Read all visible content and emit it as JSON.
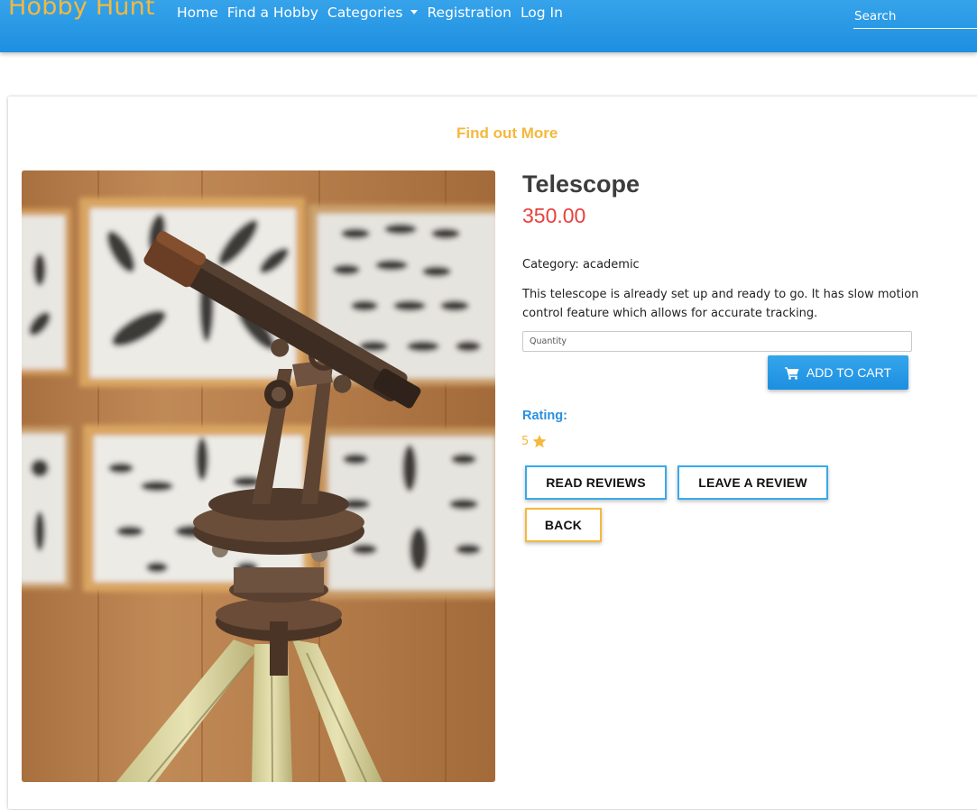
{
  "navbar": {
    "brand": "Hobby Hunt",
    "links": [
      "Home",
      "Find a Hobby",
      "Categories",
      "Registration",
      "Log In"
    ],
    "search_placeholder": "Search"
  },
  "page": {
    "section_heading": "Find out More"
  },
  "product": {
    "title": "Telescope",
    "price": "350.00",
    "category_label": "Category: academic",
    "description": "This telescope is already set up and ready to go. It has slow motion control feature which allows for accurate tracking.",
    "quantity_placeholder": "Quantity",
    "add_to_cart_label": "ADD TO CART",
    "rating_label": "Rating:",
    "rating_value": "5"
  },
  "actions": {
    "read_reviews": "READ REVIEWS",
    "leave_review": "LEAVE A REVIEW",
    "back": "BACK"
  },
  "colors": {
    "navbar": "#1e8fe0",
    "brand": "#f5b83d",
    "price": "#e8413d",
    "rating_label": "#2a8fe0",
    "accent_gold": "#f5b83d"
  },
  "icons": {
    "cart": "shopping-cart-icon",
    "star": "star-icon"
  }
}
